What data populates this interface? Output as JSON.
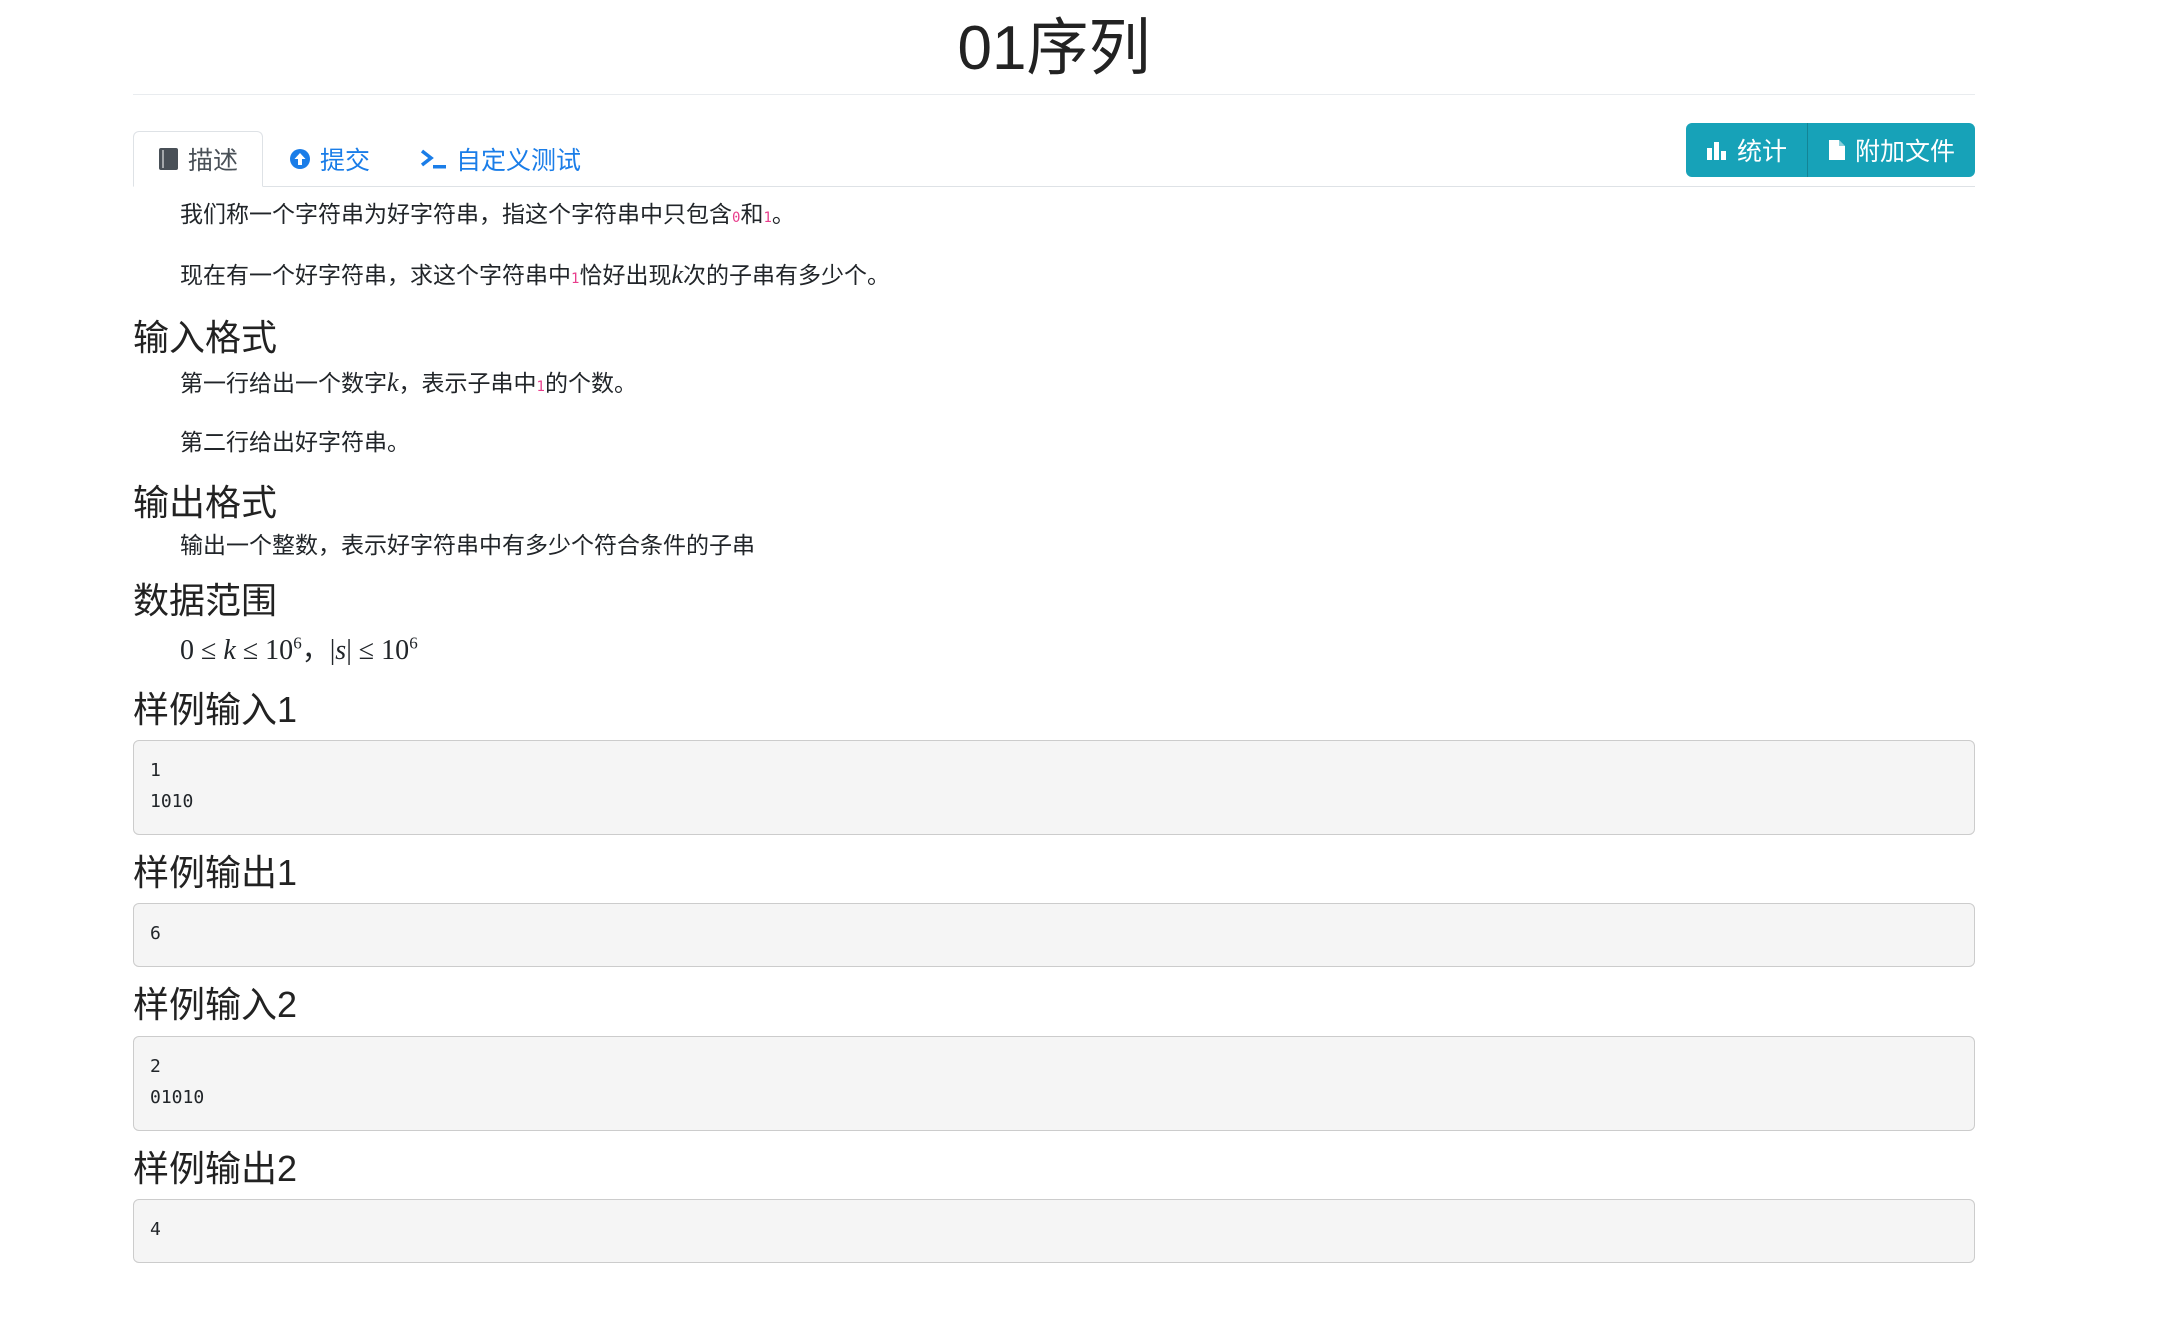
{
  "page": {
    "title": "01序列"
  },
  "tabs": [
    {
      "label": "描述",
      "icon": "book-icon",
      "active": true
    },
    {
      "label": "提交",
      "icon": "upload-circle-icon"
    },
    {
      "label": "自定义测试",
      "icon": "terminal-icon"
    }
  ],
  "buttons": {
    "stats_label": "统计",
    "attachments_label": "附加文件"
  },
  "description": {
    "p1_a": "我们称一个字符串为好字符串，指这个字符串中只包含",
    "p1_c0": "0",
    "p1_b": "和",
    "p1_c1": "1",
    "p1_end": "。",
    "p2_a": "现在有一个好字符串，求这个字符串中",
    "p2_c1": "1",
    "p2_b": "恰好出现",
    "p2_k": "k",
    "p2_c": "次的子串有多少个。"
  },
  "input_format": {
    "heading": "输入格式",
    "p1_a": "第一行给出一个数字",
    "p1_k": "k",
    "p1_b": "，表示子串中",
    "p1_c1": "1",
    "p1_c": "的个数。",
    "p2": "第二行给出好字符串。"
  },
  "output_format": {
    "heading": "输出格式",
    "p1": "输出一个整数，表示好字符串中有多少个符合条件的子串"
  },
  "constraints": {
    "heading": "数据范围",
    "formula": "0 ≤ k ≤ 10^6，|s| ≤ 10^6"
  },
  "samples": [
    {
      "heading": "样例输入1",
      "content": "1\n1010"
    },
    {
      "heading": "样例输出1",
      "content": "6"
    },
    {
      "heading": "样例输入2",
      "content": "2\n01010"
    },
    {
      "heading": "样例输出2",
      "content": "4"
    }
  ],
  "colors": {
    "accent": "#17a2b8",
    "link": "#1a7de8",
    "inline_code": "#e83e8c"
  }
}
